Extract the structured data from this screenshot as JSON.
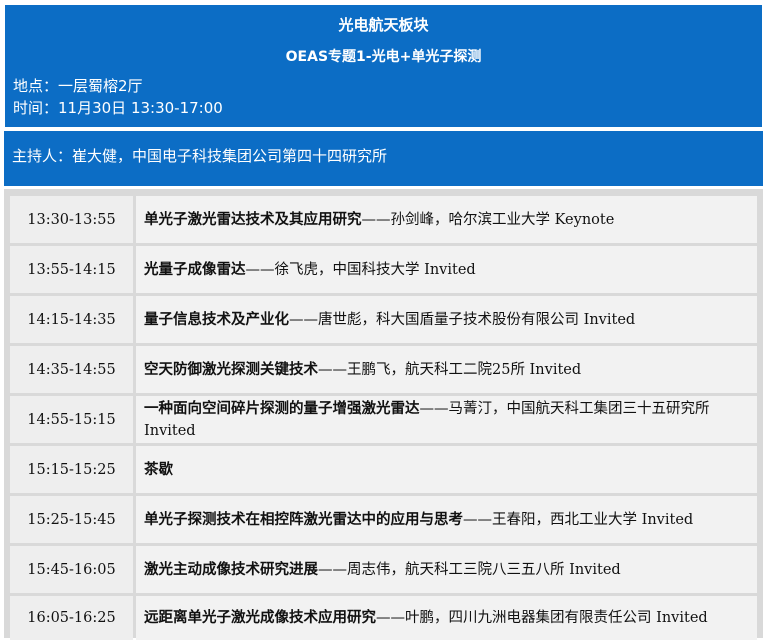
{
  "header": {
    "title": "光电航天板块",
    "subtitle": "OEAS专题1-光电+单光子探测",
    "location": "地点：一层蜀榕2厅",
    "time": "时间：11月30日 13:30-17:00"
  },
  "host": "主持人：崔大健，中国电子科技集团公司第四十四研究所",
  "schedule": [
    {
      "time": "13:30-13:55",
      "title": "单光子激光雷达技术及其应用研究",
      "detail": "——孙剑峰，哈尔滨工业大学 Keynote"
    },
    {
      "time": "13:55-14:15",
      "title": "光量子成像雷达",
      "detail": "——徐飞虎，中国科技大学 Invited"
    },
    {
      "time": "14:15-14:35",
      "title": "量子信息技术及产业化",
      "detail": "——唐世彪，科大国盾量子技术股份有限公司 Invited"
    },
    {
      "time": "14:35-14:55",
      "title": "空天防御激光探测关键技术",
      "detail": "——王鹏飞，航天科工二院25所 Invited"
    },
    {
      "time": "14:55-15:15",
      "title": "一种面向空间碎片探测的量子增强激光雷达",
      "detail": "——马菁汀，中国航天科工集团三十五研究所 Invited"
    },
    {
      "time": "15:15-15:25",
      "title": "茶歇",
      "detail": ""
    },
    {
      "time": "15:25-15:45",
      "title": "单光子探测技术在相控阵激光雷达中的应用与思考",
      "detail": "——王春阳，西北工业大学 Invited"
    },
    {
      "time": "15:45-16:05",
      "title": "激光主动成像技术研究进展",
      "detail": "——周志伟，航天科工三院八三五八所 Invited"
    },
    {
      "time": "16:05-16:25",
      "title": "远距离单光子激光成像技术应用研究",
      "detail": "——叶鹏，四川九洲电器集团有限责任公司 Invited"
    }
  ]
}
